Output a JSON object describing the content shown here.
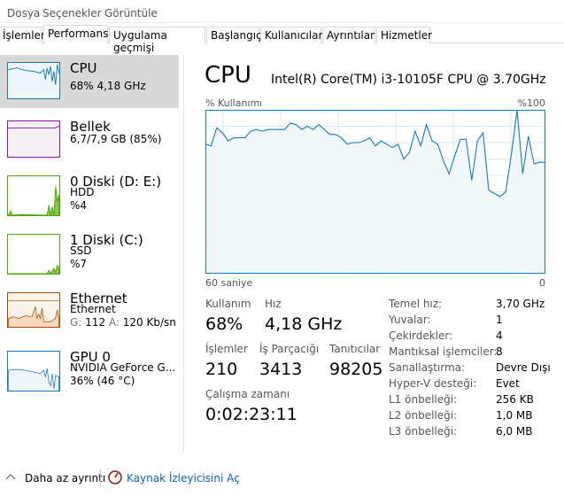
{
  "menu": {
    "items": [
      "Dosya",
      "Seçenekler",
      "Görüntüle"
    ]
  },
  "tabs": [
    "İşlemler",
    "Performans",
    "Uygulama geçmişi",
    "Başlangıç",
    "Kullanıcılar",
    "Ayrıntılar",
    "Hizmetler"
  ],
  "active_tab": "Performans",
  "sidebar": {
    "items": [
      {
        "title": "CPU",
        "line1": "68% 4,18 GHz",
        "color": "#1779ba",
        "selected": true
      },
      {
        "title": "Bellek",
        "line1": "6,7/7,9 GB (85%)",
        "color": "#8b12ae"
      },
      {
        "title": "0 Diski (D: E:)",
        "line1": "HDD",
        "line2": "%4",
        "color": "#4da60c"
      },
      {
        "title": "1 Diski (C:)",
        "line1": "SSD",
        "line2": "%7",
        "color": "#4da60c"
      },
      {
        "title": "Ethernet",
        "line1": "Ethernet",
        "send_label": "G:",
        "send": "112",
        "recv_label": "A:",
        "recv": "120 Kb/sn",
        "color": "#a74f01"
      },
      {
        "title": "GPU 0",
        "line1": "NVIDIA GeForce G...",
        "line2": "36%  (46 °C)",
        "color": "#1779ba"
      }
    ]
  },
  "main": {
    "title": "CPU",
    "model": "Intel(R) Core(TM) i3-10105F CPU @ 3.70GHz",
    "stats": {
      "usage_label": "Kullanım",
      "usage": "68%",
      "speed_label": "Hız",
      "speed": "4,18 GHz",
      "processes_label": "İşlemler",
      "processes": "210",
      "threads_label": "İş Parçacığı",
      "threads": "3413",
      "handles_label": "Tanıtıcılar",
      "handles": "98205",
      "uptime_label": "Çalışma zamanı",
      "uptime": "0:02:23:11"
    },
    "specs": [
      {
        "label": "Temel hız:",
        "value": "3,70 GHz"
      },
      {
        "label": "Yuvalar:",
        "value": "1"
      },
      {
        "label": "Çekirdekler:",
        "value": "4"
      },
      {
        "label": "Mantıksal işlemciler:",
        "value": "8"
      },
      {
        "label": "Sanallaştırma:",
        "value": "Devre Dışı"
      },
      {
        "label": "Hyper-V desteği:",
        "value": "Evet"
      },
      {
        "label": "L1 önbelleği:",
        "value": "256 KB"
      },
      {
        "label": "L2 önbelleği:",
        "value": "1,0 MB"
      },
      {
        "label": "L3 önbelleği:",
        "value": "6,0 MB"
      }
    ]
  },
  "chart_data": {
    "type": "area",
    "ylabel": "% Kullanımı",
    "ymax_label": "%100",
    "xmin_label": "60 saniye",
    "xmax_label": "0",
    "ylim": [
      0,
      100
    ],
    "xlim": [
      60,
      0
    ],
    "grid": true,
    "color": "#1779ba",
    "fill": "#f1f6fa",
    "x_seconds_ago": [
      60,
      59,
      58,
      57,
      56,
      55,
      54,
      53,
      52,
      51,
      50,
      49,
      48,
      47,
      46,
      45,
      44,
      43,
      42,
      41,
      40,
      39,
      38,
      37,
      36,
      35,
      34,
      33,
      32,
      31,
      30,
      29,
      28,
      27,
      26,
      25,
      24,
      23,
      22,
      21,
      20,
      19,
      18,
      17,
      16,
      15,
      14,
      13,
      12,
      11,
      10,
      9,
      8,
      7,
      6,
      5,
      4,
      3,
      2,
      1,
      0
    ],
    "values": [
      79,
      78,
      89,
      86,
      81,
      83,
      83,
      83,
      87,
      88,
      87,
      88,
      88,
      88,
      88,
      92,
      91,
      88,
      90,
      88,
      91,
      88,
      85,
      85,
      83,
      79,
      80,
      80,
      81,
      83,
      78,
      81,
      79,
      77,
      79,
      70,
      74,
      87,
      78,
      91,
      81,
      79,
      69,
      61,
      72,
      82,
      82,
      57,
      81,
      86,
      51,
      49,
      47,
      50,
      73,
      100,
      61,
      84,
      67,
      68,
      68
    ]
  },
  "footer": {
    "less_details": "Daha az ayrıntı",
    "resource_monitor": "Kaynak İzleyicisini Aç"
  }
}
